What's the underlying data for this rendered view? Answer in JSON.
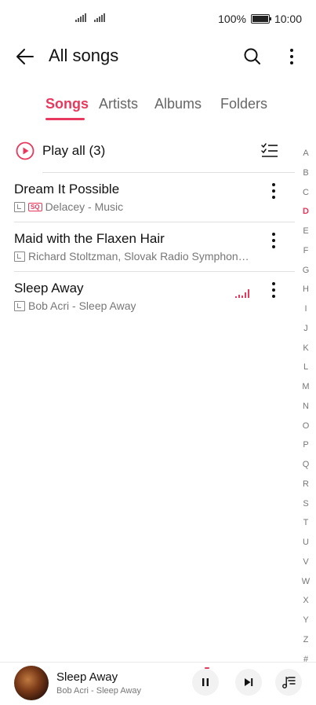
{
  "status_bar": {
    "battery": "100%",
    "time": "10:00"
  },
  "header": {
    "title": "All songs"
  },
  "tabs": [
    {
      "label": "Songs",
      "active": true
    },
    {
      "label": "Artists",
      "active": false
    },
    {
      "label": "Albums",
      "active": false
    },
    {
      "label": "Folders",
      "active": false
    }
  ],
  "play_all": {
    "label": "Play all (3)"
  },
  "songs": [
    {
      "title": "Dream It Possible",
      "subtitle": "Delacey - Music",
      "sq_badge": "SQ",
      "playing": false
    },
    {
      "title": "Maid with the Flaxen Hair",
      "subtitle": "Richard Stoltzman, Slovak Radio Symphon…",
      "playing": false
    },
    {
      "title": "Sleep Away",
      "subtitle": "Bob Acri - Sleep Away",
      "playing": true
    }
  ],
  "index_letters": [
    "A",
    "B",
    "C",
    "D",
    "E",
    "F",
    "G",
    "H",
    "I",
    "J",
    "K",
    "L",
    "M",
    "N",
    "O",
    "P",
    "Q",
    "R",
    "S",
    "T",
    "U",
    "V",
    "W",
    "X",
    "Y",
    "Z",
    "#"
  ],
  "index_active": "D",
  "now_playing": {
    "title": "Sleep Away",
    "subtitle": "Bob Acri - Sleep Away"
  },
  "colors": {
    "accent": "#e8385d",
    "text": "#111111",
    "secondary": "#777777"
  }
}
